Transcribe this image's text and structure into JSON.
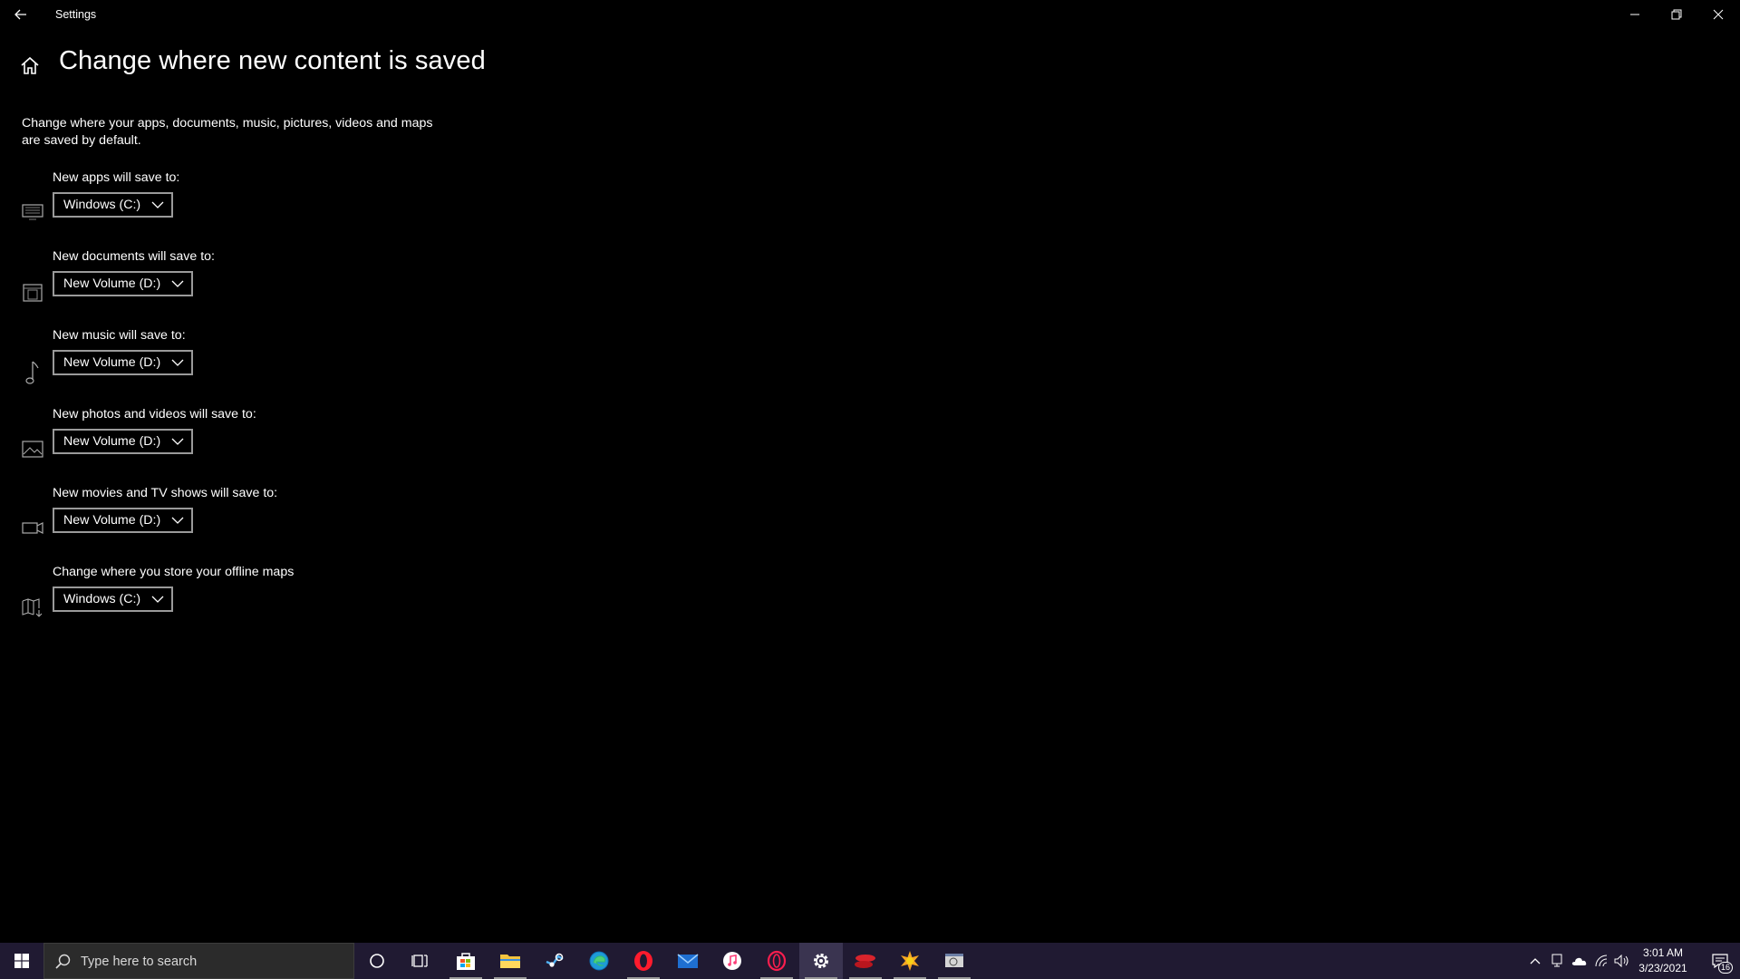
{
  "window": {
    "title": "Settings",
    "back_icon": "back-arrow-icon",
    "minimize_icon": "minimize-icon",
    "restore_icon": "restore-icon",
    "close_icon": "close-icon"
  },
  "header": {
    "home_icon": "home-icon",
    "title": "Change where new content is saved"
  },
  "description": "Change where your apps, documents, music, pictures, videos and maps are saved by default.",
  "sections": [
    {
      "label": "New apps will save to:",
      "value": "Windows (C:)",
      "icon": "monitor-icon"
    },
    {
      "label": "New documents will save to:",
      "value": "New Volume (D:)",
      "icon": "document-printer-icon"
    },
    {
      "label": "New music will save to:",
      "value": "New Volume (D:)",
      "icon": "music-note-icon"
    },
    {
      "label": "New photos and videos will save to:",
      "value": "New Volume (D:)",
      "icon": "picture-icon"
    },
    {
      "label": "New movies and TV shows will save to:",
      "value": "New Volume (D:)",
      "icon": "video-camera-icon"
    },
    {
      "label": "Change where you store your offline maps",
      "value": "Windows (C:)",
      "icon": "map-download-icon"
    }
  ],
  "taskbar": {
    "search_placeholder": "Type here to search",
    "apps": [
      "cortana-icon",
      "task-view-icon",
      "store-icon",
      "file-explorer-icon",
      "steam-icon",
      "edge-icon",
      "opera-icon",
      "mail-icon",
      "itunes-icon",
      "opera-gx-icon",
      "settings-gear-icon",
      "app-red-icon",
      "app-orange-icon",
      "app-window-icon"
    ],
    "tray": [
      "chevron-up-icon",
      "device-icon",
      "onedrive-cloud-icon",
      "wifi-icon",
      "volume-icon"
    ],
    "time": "3:01 AM",
    "date": "3/23/2021",
    "notification_count": "16"
  }
}
